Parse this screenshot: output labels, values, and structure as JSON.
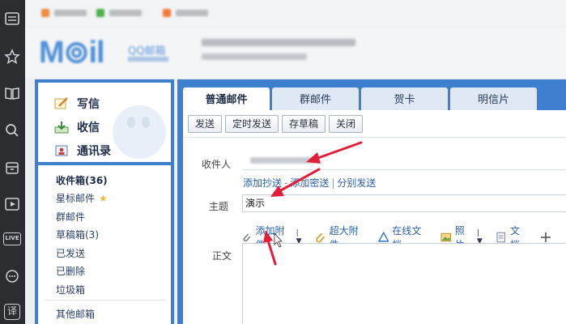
{
  "sidebar_actions": {
    "write": "写信",
    "receive": "收信",
    "contacts": "通讯录"
  },
  "folders": [
    {
      "label": "收件箱(36)",
      "bold": true
    },
    {
      "label": "星标邮件",
      "star": "★"
    },
    {
      "label": "群邮件"
    },
    {
      "label": "草稿箱(3)"
    },
    {
      "label": "已发送"
    },
    {
      "label": "已删除"
    },
    {
      "label": "垃圾箱"
    }
  ],
  "other_folders": "其他邮箱",
  "tabs": [
    "普通邮件",
    "群邮件",
    "贺卡",
    "明信片"
  ],
  "toolbar": {
    "send": "发送",
    "scheduled": "定时发送",
    "save_draft": "存草稿",
    "close": "关闭"
  },
  "fields": {
    "recipient_label": "收件人",
    "links": [
      "添加抄送",
      "添加密送",
      "分别发送"
    ],
    "link_sep_dash": "-",
    "link_sep_bar": "|",
    "subject_label": "主题",
    "subject_value": "演示",
    "body_label": "正文"
  },
  "attach_toolbar": {
    "add_attachment": "添加附件",
    "large_attachment": "超大附件",
    "online_doc": "在线文档",
    "photo": "照片",
    "document": "文档"
  },
  "colors": {
    "panel_blue": "#3f7fd0",
    "arrow_red": "#e0203a",
    "link_blue": "#2a5fa8"
  }
}
